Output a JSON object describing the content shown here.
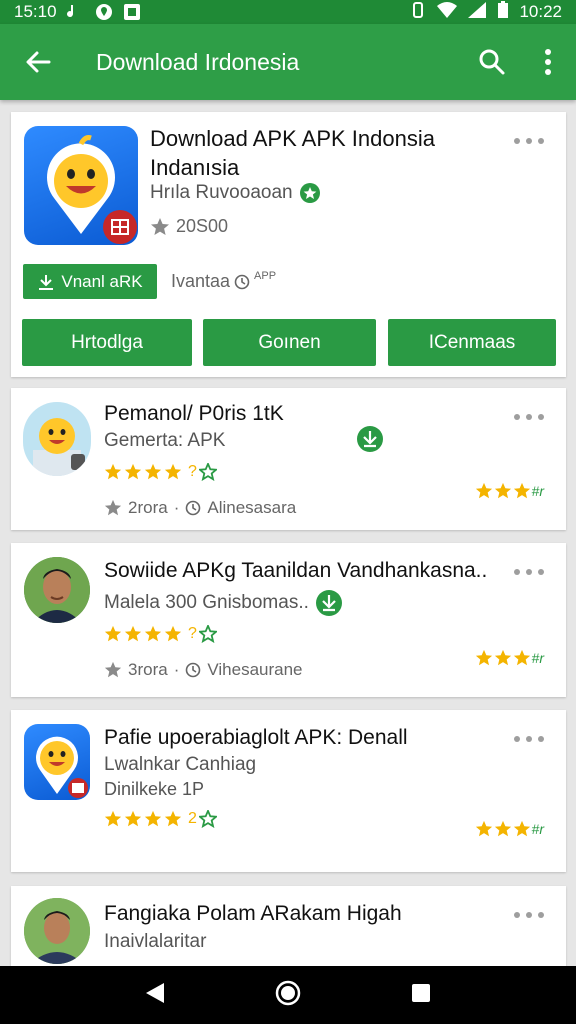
{
  "status_bar": {
    "time_left": "15:10",
    "time_right": "10:22"
  },
  "app_bar": {
    "title": "Download Irdonesia"
  },
  "featured": {
    "title_line1": "Download APK APK Indonsia",
    "title_line2": "Indanısia",
    "developer": "Hrıla Ruvooaoan",
    "rating_text": "20S00",
    "install_label": "Vnanl aRK",
    "extra_label": "Ivantaa",
    "extra_tag": "APP",
    "buttons": [
      "Hrtodlga",
      "Goınen",
      "ICenmaas"
    ]
  },
  "items": [
    {
      "title": "Pemanol/ P0ris 1tK",
      "subtitle": "Gemerta: APK",
      "rating_num": "?",
      "meta_size": "2rora",
      "meta_label": "Alinesasara",
      "mini": "#r"
    },
    {
      "title": "Sowiide APKg Taanildan Vandhankasna..",
      "subtitle": "Malela 300 Gnisbomas..",
      "rating_num": "?",
      "meta_size": "3rora",
      "meta_label": "Vihesaurane",
      "mini": "#r"
    },
    {
      "title": "Pafie upoerabiaglolt APK: Denall",
      "subtitle": "Lwalnkar Canhiag",
      "subtitle2": "Dinilkeke 1P",
      "rating_num": "2",
      "mini": "#r"
    },
    {
      "title": "Fangiaka Polam ARakam Higah",
      "subtitle": "Inaivlalaritar"
    }
  ],
  "colors": {
    "primary": "#2e9e47",
    "status": "#1f8a36",
    "star": "#f4b400",
    "button": "#2a9a44"
  }
}
